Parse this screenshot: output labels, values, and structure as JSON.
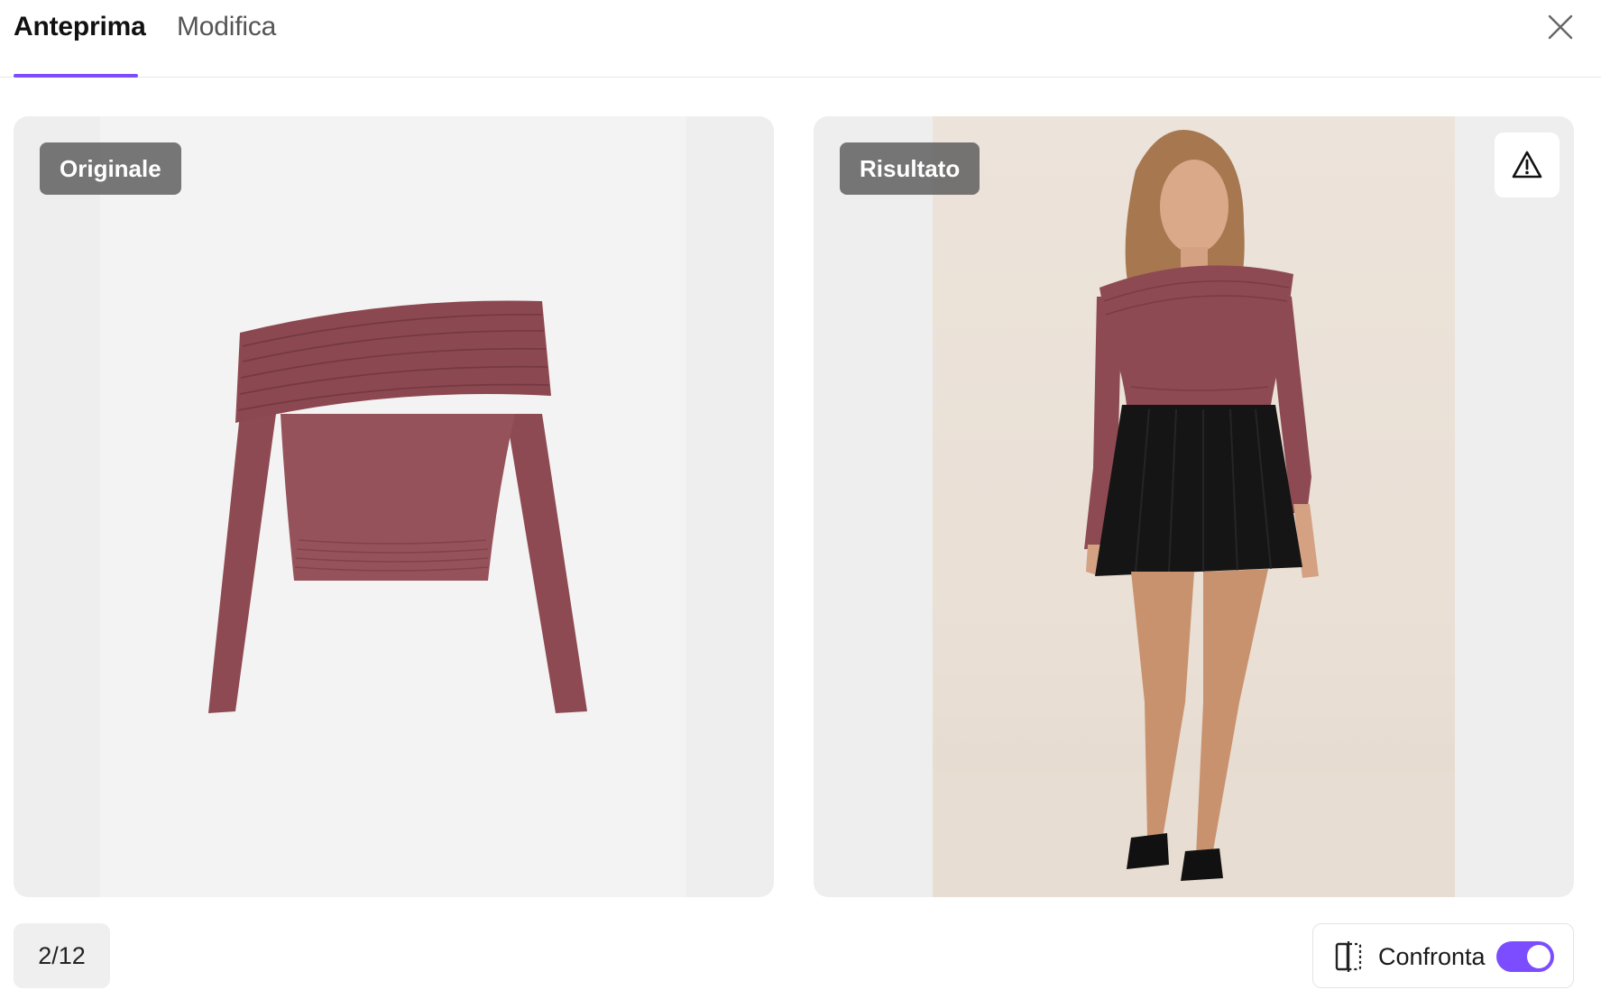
{
  "tabs": {
    "preview_label": "Anteprima",
    "edit_label": "Modifica",
    "active": "Anteprima"
  },
  "original_panel": {
    "badge": "Originale",
    "image": "maroon off-shoulder long-sleeve top"
  },
  "result_panel": {
    "badge": "Risultato",
    "image": "model wearing maroon off-shoulder top with black pleated mini skirt and black heeled sandals"
  },
  "icons": {
    "close": "close-icon",
    "warning": "warning-triangle-icon",
    "compare": "compare-split-icon"
  },
  "footer": {
    "counter": "2/12",
    "compare_label": "Confronta",
    "compare_enabled": true
  },
  "colors": {
    "accent": "#7b4dff",
    "garment": "#8e4a52",
    "badge_bg": "#5a5a5a"
  }
}
